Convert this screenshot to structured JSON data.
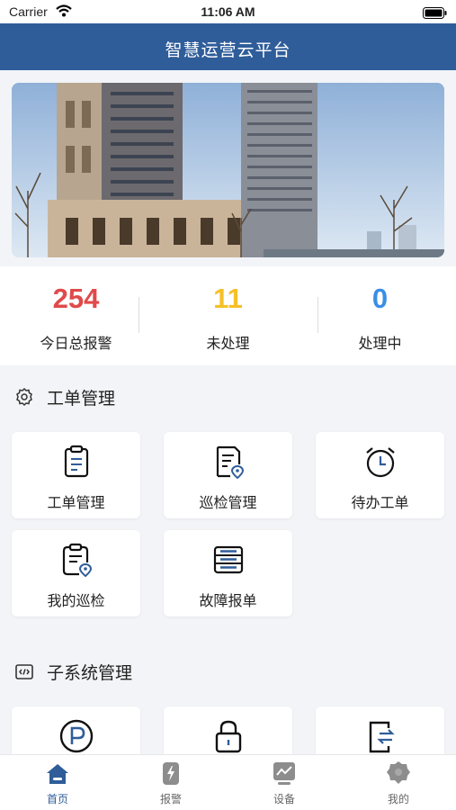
{
  "status_bar": {
    "carrier": "Carrier",
    "time": "11:06 AM"
  },
  "header": {
    "title": "智慧运营云平台"
  },
  "stats": [
    {
      "value": "254",
      "label": "今日总报警",
      "color": "#e04a4a"
    },
    {
      "value": "11",
      "label": "未处理",
      "color": "#f5c028"
    },
    {
      "value": "0",
      "label": "处理中",
      "color": "#3a8ee6"
    }
  ],
  "sections": {
    "work_orders": {
      "title": "工单管理",
      "items": [
        {
          "label": "工单管理",
          "icon": "clipboard-icon"
        },
        {
          "label": "巡检管理",
          "icon": "document-location-icon"
        },
        {
          "label": "待办工单",
          "icon": "alarm-clock-icon"
        },
        {
          "label": "我的巡检",
          "icon": "clipboard-location-icon"
        },
        {
          "label": "故障报单",
          "icon": "server-list-icon"
        }
      ]
    },
    "subsystems": {
      "title": "子系统管理",
      "items": [
        {
          "label": "",
          "icon": "parking-icon"
        },
        {
          "label": "",
          "icon": "lock-icon"
        },
        {
          "label": "",
          "icon": "door-exchange-icon"
        }
      ]
    }
  },
  "tabs": [
    {
      "label": "首页",
      "icon": "home-icon",
      "active": true
    },
    {
      "label": "报警",
      "icon": "alarm-icon",
      "active": false
    },
    {
      "label": "设备",
      "icon": "monitor-icon",
      "active": false
    },
    {
      "label": "我的",
      "icon": "profile-icon",
      "active": false
    }
  ],
  "colors": {
    "primary": "#2f5d9a",
    "tab_inactive": "#9a9a9a"
  }
}
